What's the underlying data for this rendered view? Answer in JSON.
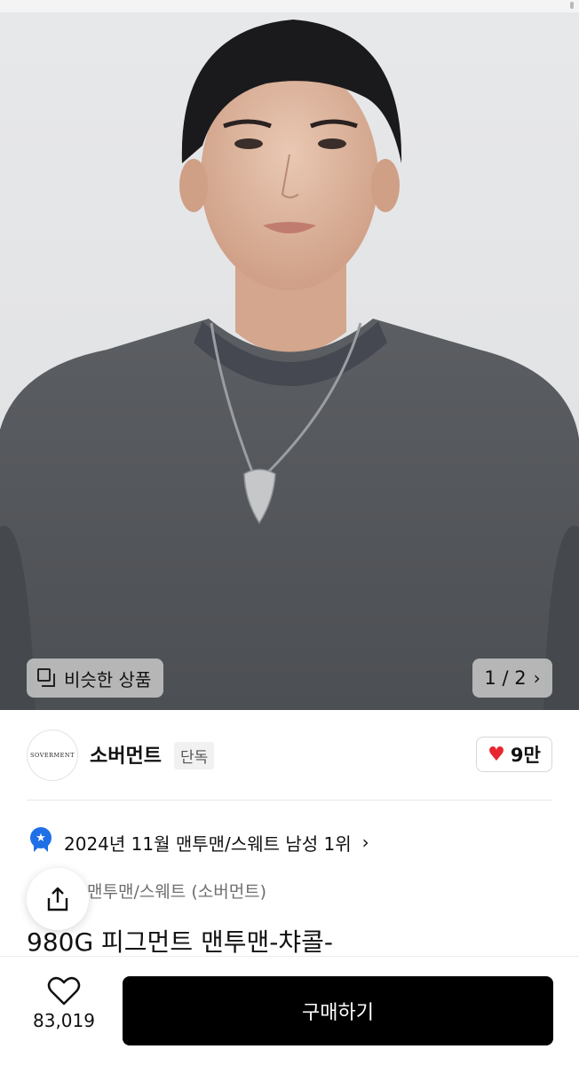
{
  "product_image": {
    "similar_label": "비슷한 상품",
    "counter_current": "1",
    "counter_total": "2",
    "counter_text": "1 / 2"
  },
  "brand": {
    "logo_text": "SOVERMENT",
    "name": "소버먼트",
    "badge": "단독",
    "likes": "9만"
  },
  "ranking": {
    "text": "2024년 11월 맨투맨/스웨트 남성 1위"
  },
  "product": {
    "category": "맨투맨/스웨트 (소버먼트)",
    "title": "980G 피그먼트 맨투맨-챠콜-"
  },
  "bottom_bar": {
    "wish_count": "83,019",
    "buy_label": "구매하기"
  },
  "colors": {
    "heart_red": "#e8262f",
    "rank_blue": "#1f6fe6",
    "buy_button": "#000000"
  }
}
